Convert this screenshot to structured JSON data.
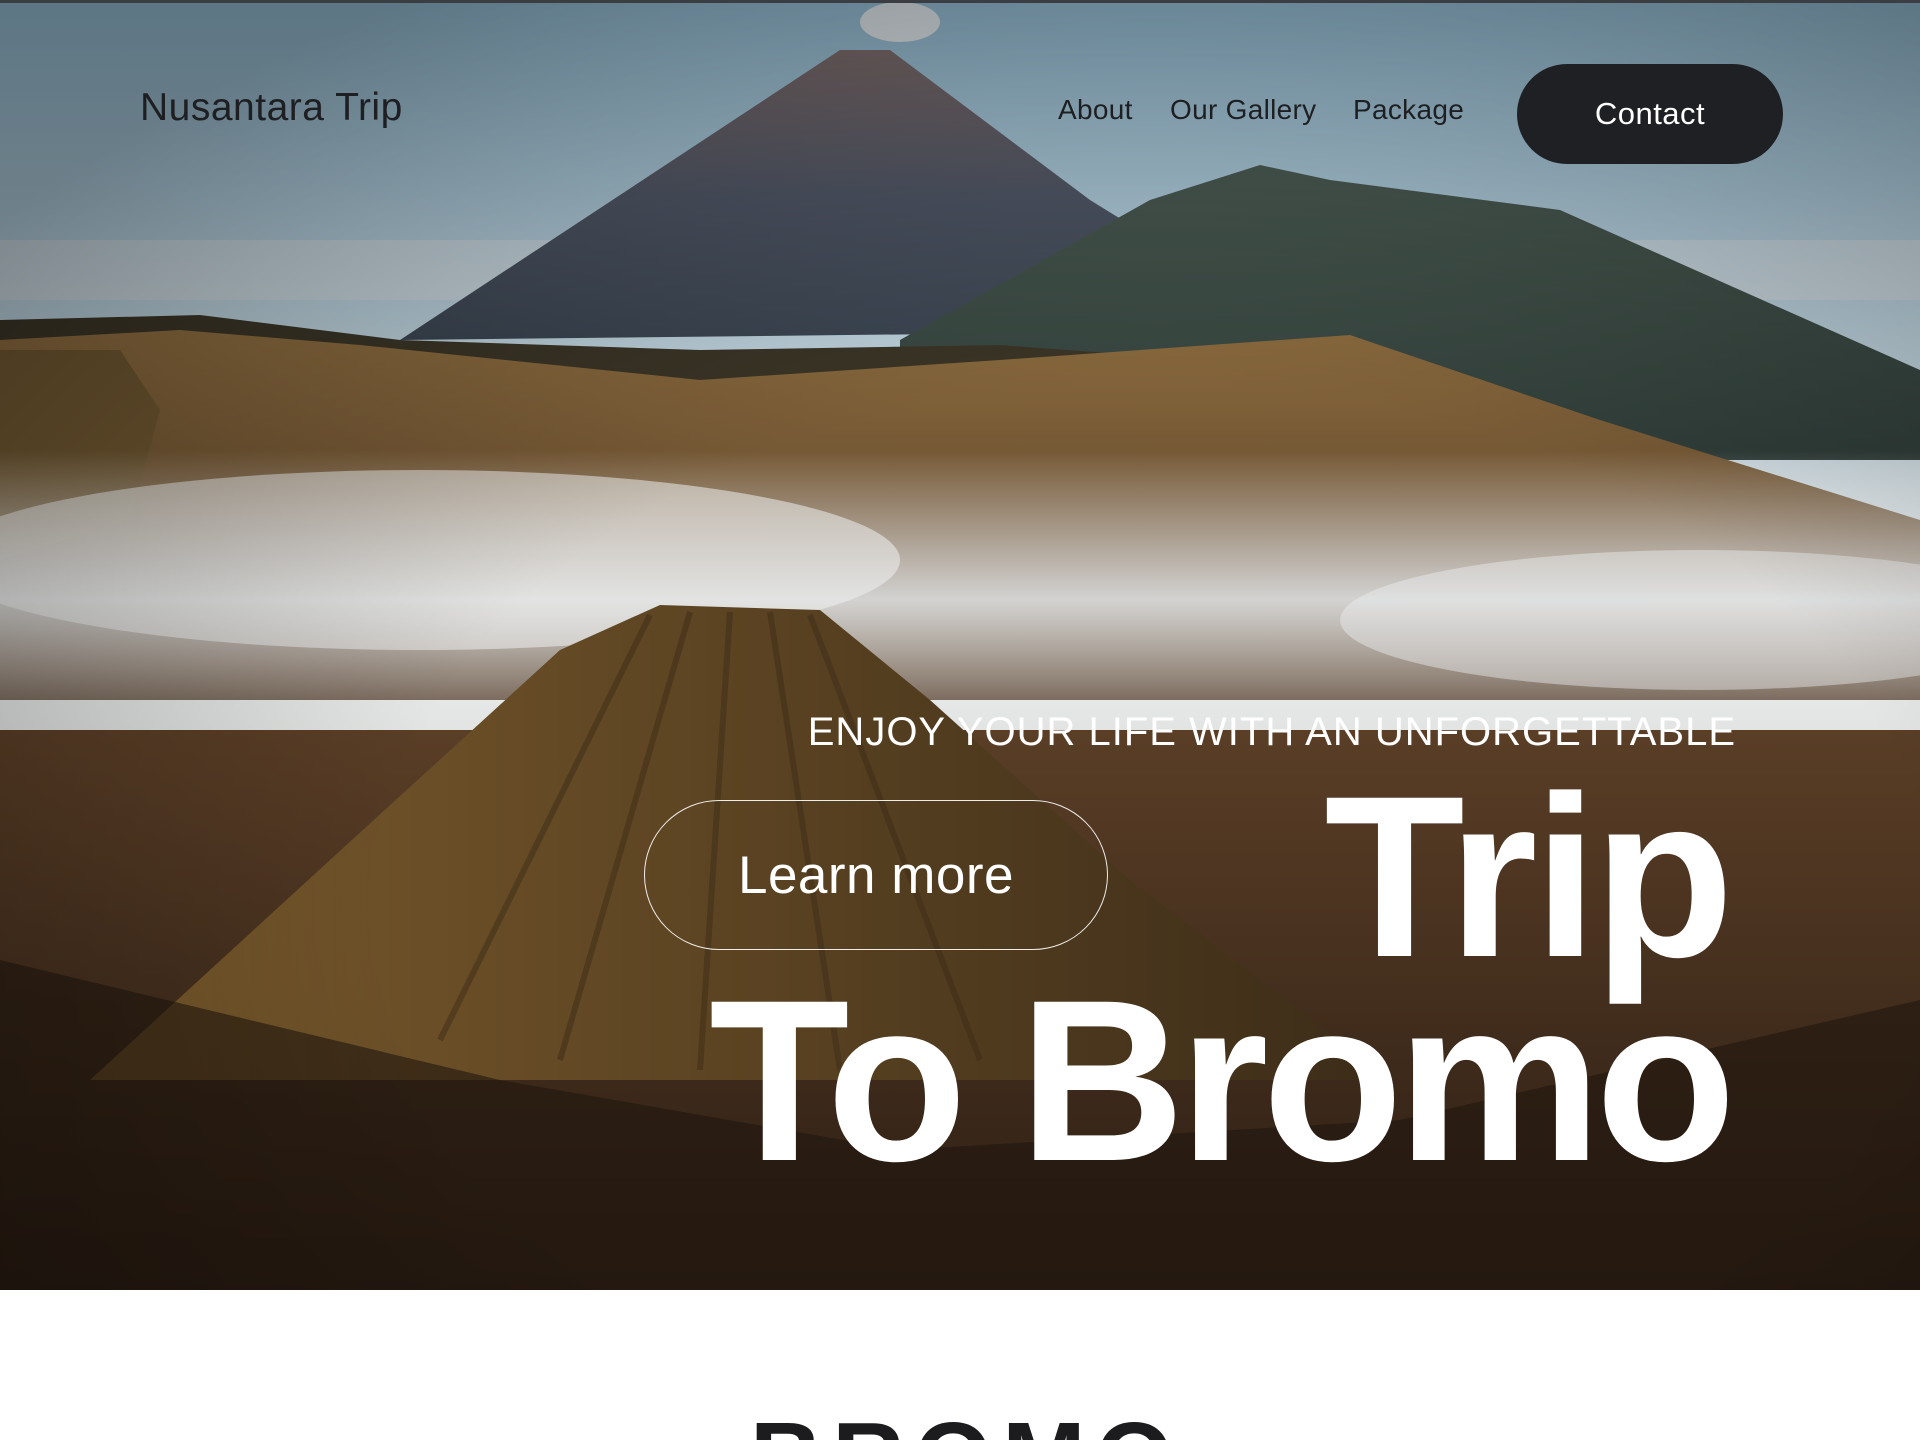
{
  "header": {
    "brand": "Nusantara Trip",
    "nav": {
      "about": "About",
      "gallery": "Our Gallery",
      "package": "Package"
    },
    "contact_label": "Contact"
  },
  "hero": {
    "tagline": "ENJOY YOUR LIFE WITH AN UNFORGETTABLE",
    "title_line1": "Trip",
    "title_line2": "To Bromo",
    "cta_label": "Learn more",
    "image": "bromo-volcano-landscape"
  },
  "section": {
    "heading": "BROMO"
  },
  "colors": {
    "text_dark": "#1e1f22",
    "button_dark": "#1f2024",
    "text_light": "#ffffff",
    "page_bg": "#ffffff"
  }
}
